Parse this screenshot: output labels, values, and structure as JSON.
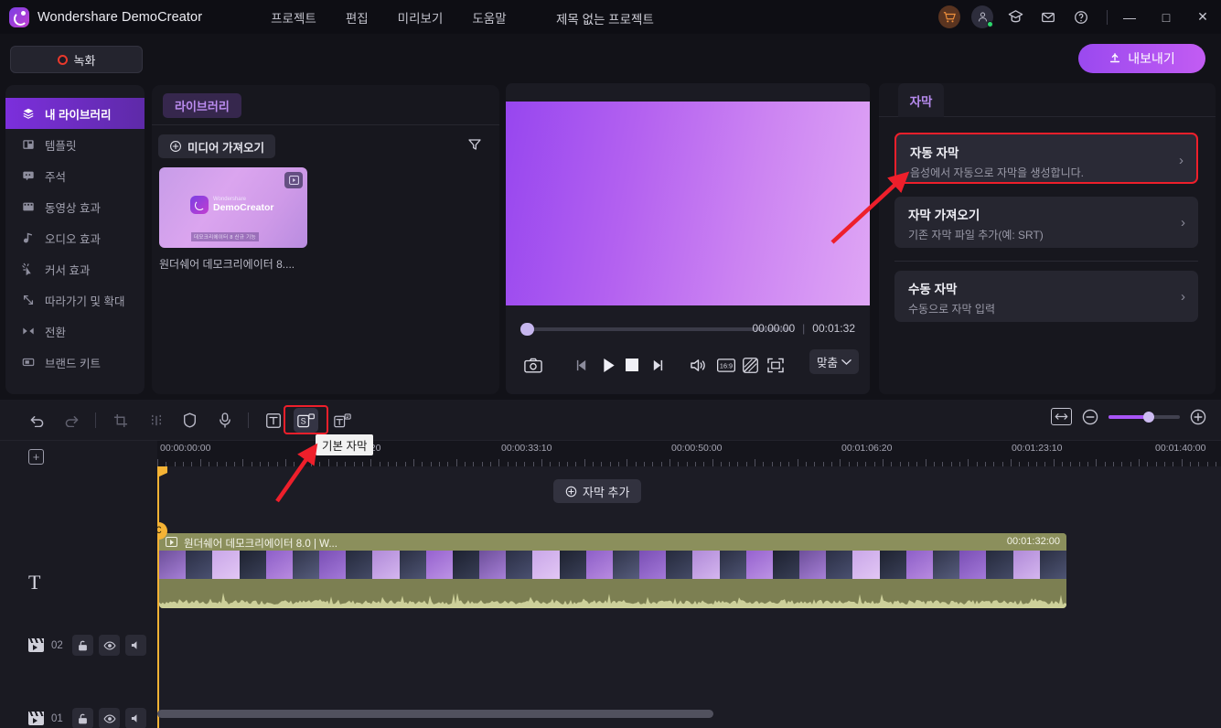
{
  "titlebar": {
    "brand": "Wondershare DemoCreator",
    "menu": [
      "프로젝트",
      "편집",
      "미리보기",
      "도움말"
    ],
    "project_title": "제목 없는 프로젝트",
    "icons": [
      "cart-icon",
      "user-icon",
      "graduation-cap-icon",
      "mail-icon",
      "help-icon"
    ],
    "window_controls": {
      "minimize": "—",
      "maximize": "□",
      "close": "✕"
    }
  },
  "actions": {
    "record_label": "녹화",
    "export_label": "내보내기",
    "export_color": "#a855f7"
  },
  "sidebar": {
    "items": [
      {
        "label": "내 라이브러리",
        "icon": "layers-icon",
        "active": true
      },
      {
        "label": "템플릿",
        "icon": "template-icon",
        "active": false
      },
      {
        "label": "주석",
        "icon": "comment-icon",
        "active": false
      },
      {
        "label": "동영상 효과",
        "icon": "video-effect-icon",
        "active": false
      },
      {
        "label": "오디오 효과",
        "icon": "audio-effect-icon",
        "active": false
      },
      {
        "label": "커서 효과",
        "icon": "cursor-effect-icon",
        "active": false
      },
      {
        "label": "따라가기 및 확대",
        "icon": "pan-zoom-icon",
        "active": false
      },
      {
        "label": "전환",
        "icon": "transition-icon",
        "active": false
      },
      {
        "label": "브랜드 키트",
        "icon": "brand-kit-icon",
        "active": false
      }
    ]
  },
  "library": {
    "tab": "라이브러리",
    "import_label": "미디어 가져오기",
    "filter_icon": "filter-icon",
    "media": [
      {
        "name": "원더쉐어 데모크리에이터 8....",
        "thumb_brand_top": "Wondershare",
        "thumb_brand_bottom": "DemoCreator",
        "thumb_sub": "데모크리에이터 8 신규 기능",
        "badge_icon": "video-badge-icon"
      }
    ]
  },
  "preview": {
    "current_time": "00:00:00",
    "total_time": "00:01:32",
    "time_separator": "|",
    "controls": [
      "snapshot-icon",
      "prev-frame-icon",
      "play-icon",
      "stop-icon",
      "next-frame-icon",
      "volume-icon",
      "aspect-ratio-icon",
      "no-signal-icon",
      "fullscreen-icon"
    ],
    "aspect_label": "16:9",
    "fit_label": "맞춤",
    "gradient_from": "#9746ef",
    "gradient_to": "#dfa6f5"
  },
  "subtitle_panel": {
    "tab": "자막",
    "options": [
      {
        "title": "자동 자막",
        "desc": "음성에서 자동으로 자막을 생성합니다.",
        "highlighted": true
      },
      {
        "title": "자막 가져오기",
        "desc": "기존 자막 파일 추가(예: SRT)",
        "highlighted": false
      },
      {
        "title": "수동 자막",
        "desc": "수동으로 자막 입력",
        "highlighted": false
      }
    ],
    "highlight_color": "#ee1f2b"
  },
  "timeline": {
    "toolbar": [
      {
        "name": "undo-icon",
        "dim": false
      },
      {
        "name": "redo-icon",
        "dim": true
      },
      {
        "name": "crop-icon",
        "dim": true
      },
      {
        "name": "split-icon",
        "dim": true
      },
      {
        "name": "mask-icon",
        "dim": false
      },
      {
        "name": "mic-icon",
        "dim": false
      },
      {
        "name": "text-icon",
        "dim": false
      },
      {
        "name": "subtitle-icon",
        "dim": false
      },
      {
        "name": "caption-icon",
        "dim": false
      }
    ],
    "tooltip": "기본 자막",
    "zoom": {
      "fit_icon": "fit-to-width-icon",
      "minus_icon": "zoom-out-icon",
      "plus_icon": "zoom-in-icon",
      "value_percent": 55
    },
    "add_track_icon": "add-track-icon",
    "ruler_labels": [
      "00:00:00:00",
      "00:00:16:20",
      "00:00:33:10",
      "00:00:50:00",
      "00:01:06:20",
      "00:01:23:10",
      "00:01:40:00"
    ],
    "add_subtitle_label": "자막 추가",
    "playhead_badge": "C",
    "tracks": [
      {
        "type": "text",
        "icon": "text-track-icon",
        "label": "T"
      },
      {
        "type": "video",
        "icon": "video-track-icon",
        "number": "02",
        "buttons": [
          "lock-icon",
          "eye-icon",
          "mute-icon"
        ]
      },
      {
        "type": "video",
        "icon": "video-track-icon",
        "number": "01",
        "buttons": [
          "lock-icon",
          "eye-icon",
          "mute-icon"
        ]
      }
    ],
    "clip": {
      "title": "원더쉐어 데모크리에이터 8.0 |  W...",
      "duration": "00:01:32:00",
      "color": "#8b8f5c"
    }
  }
}
